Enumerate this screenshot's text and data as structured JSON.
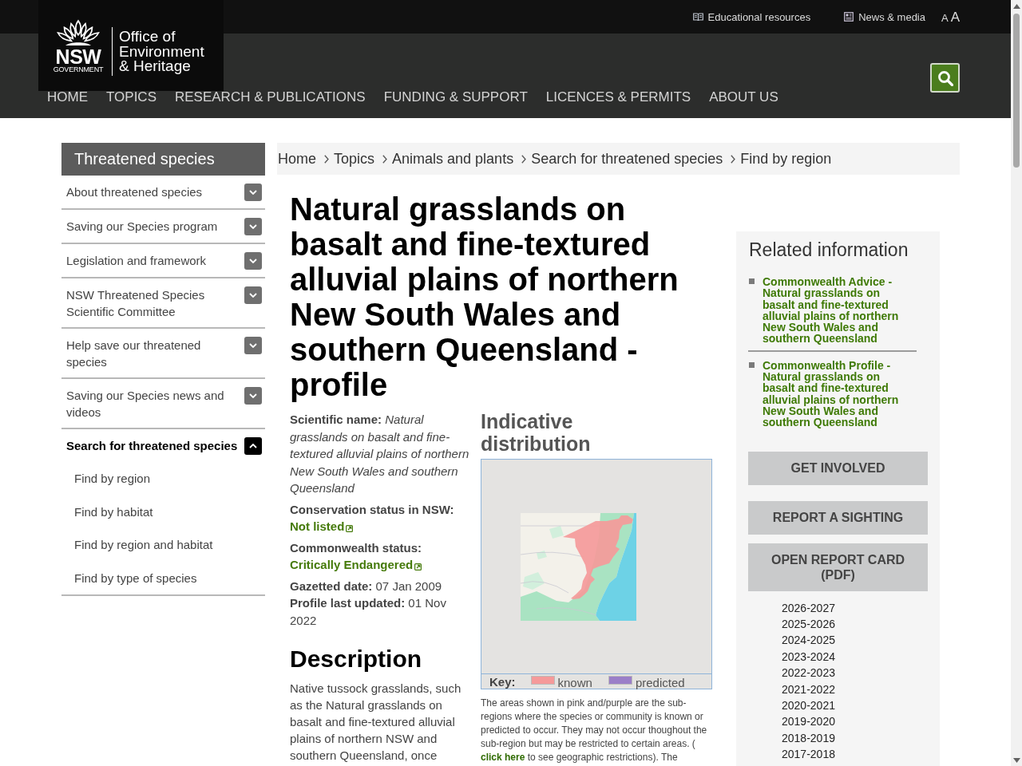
{
  "top_bar": {
    "links": [
      {
        "label": "Educational resources",
        "kind": "resources"
      },
      {
        "label": "News & media",
        "kind": "news"
      }
    ],
    "text_size": [
      {
        "label": "A",
        "kind": "smaller"
      },
      {
        "label": "A",
        "kind": "larger"
      }
    ]
  },
  "logo": {
    "mark": "NSW",
    "mark_sub": "GOVERNMENT",
    "name_lines": [
      "Office of",
      "Environment",
      "& Heritage"
    ]
  },
  "nav": [
    "HOME",
    "TOPICS",
    "RESEARCH & PUBLICATIONS",
    "FUNDING & SUPPORT",
    "LICENCES & PERMITS",
    "ABOUT US"
  ],
  "sidebar": {
    "title": "Threatened species",
    "items": [
      {
        "label": "About threatened species",
        "expanded": false
      },
      {
        "label": "Saving our Species program",
        "expanded": false
      },
      {
        "label": "Legislation and framework",
        "expanded": false
      },
      {
        "label": "NSW Threatened Species Scientific Committee",
        "expanded": false
      },
      {
        "label": "Help save our threatened species",
        "expanded": false
      },
      {
        "label": "Saving our Species news and videos",
        "expanded": false
      },
      {
        "label": "Search for threatened species",
        "expanded": true,
        "children": [
          {
            "label": "Find by region"
          },
          {
            "label": "Find by habitat"
          },
          {
            "label": "Find by region and habitat"
          },
          {
            "label": "Find by type of species"
          }
        ]
      }
    ]
  },
  "breadcrumb": [
    "Home",
    "Topics",
    "Animals and plants",
    "Search for threatened species",
    "Find by region"
  ],
  "profile": {
    "title": "Natural grasslands on basalt and fine-textured alluvial plains of northern New South Wales and southern Queensland - profile",
    "facts": [
      {
        "label": "Scientific name:",
        "value": "Natural grasslands on basalt and fine-textured alluvial plains of northern New South Wales and southern Queensland",
        "kind": "italic"
      },
      {
        "label": "Conservation status in NSW:",
        "value": "Not listed",
        "kind": "link"
      },
      {
        "label": "Commonwealth status:",
        "value": "Critically Endangered",
        "kind": "link"
      },
      {
        "label": "Gazetted date:",
        "value": "07 Jan 2009",
        "kind": "plain"
      },
      {
        "label": "Profile last updated:",
        "value": "01 Nov 2022",
        "kind": "plain"
      }
    ],
    "description": {
      "heading": "Description",
      "text": "Native tussock grasslands, such as the Natural grasslands on basalt and fine-textured alluvial plains of northern NSW and southern Queensland, once"
    }
  },
  "distribution": {
    "heading": "Indicative distribution",
    "key_label": "Key:",
    "key": [
      {
        "label": "known",
        "color": "#f59a9a"
      },
      {
        "label": "predicted",
        "color": "#9b7fc8"
      }
    ],
    "caption": "The areas shown in pink and/purple are the sub-regions where the species or community is known or predicted to occur. They may not occur thoughout the sub-region but may be restricted to certain areas. (",
    "caption_link": "click here",
    "caption_end": "to see geographic restrictions). The"
  },
  "related": {
    "heading": "Related information",
    "links": [
      "Commonwealth Advice - Natural grasslands on basalt and fine-textured alluvial plains of northern New South Wales and southern Queensland",
      "Commonwealth Profile - Natural grasslands on basalt and fine-textured alluvial plains of northern New South Wales and southern Queensland"
    ]
  },
  "actions": [
    "GET INVOLVED",
    "REPORT A SIGHTING",
    "OPEN REPORT CARD (PDF)"
  ],
  "report_years": [
    "2026-2027",
    "2025-2026",
    "2024-2025",
    "2023-2024",
    "2022-2023",
    "2021-2022",
    "2020-2021",
    "2019-2020",
    "2018-2019",
    "2017-2018"
  ]
}
